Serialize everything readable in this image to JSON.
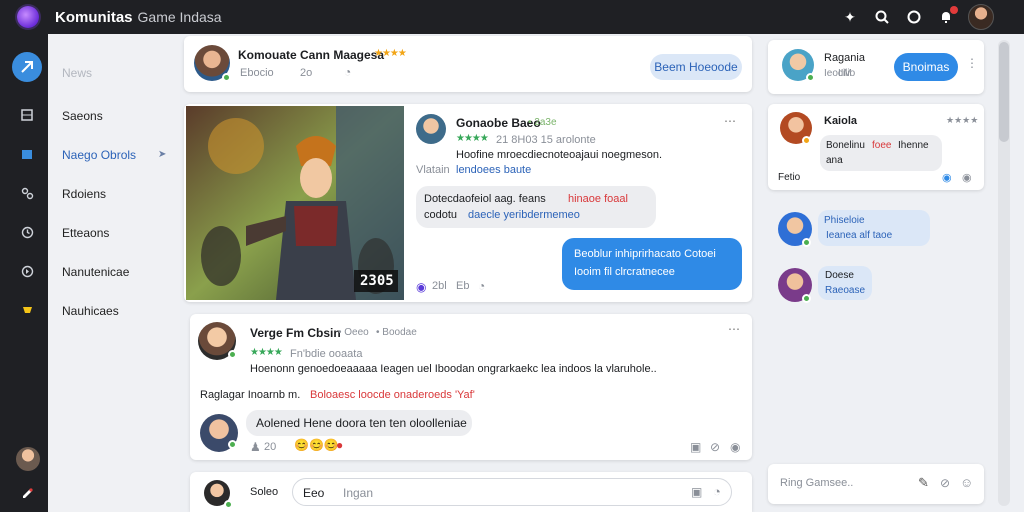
{
  "app": {
    "title": "Komunitas",
    "subtitle": "Game Indasa"
  },
  "nav": {
    "items": [
      {
        "label": "News",
        "state": "muted"
      },
      {
        "label": "Saeons",
        "state": "normal"
      },
      {
        "label": "Naego Obrols",
        "state": "active"
      },
      {
        "label": "Rdoiens",
        "state": "normal"
      },
      {
        "label": "Etteaons",
        "state": "normal"
      },
      {
        "label": "Nanutenicae",
        "state": "normal"
      },
      {
        "label": "Nauhicaes",
        "state": "normal"
      }
    ]
  },
  "profile_card": {
    "name": "Komouate Cann Maagesa",
    "stars": "★★★★",
    "meta1": "Ebocio",
    "meta2": "2o",
    "button": "Beem Hoeoode"
  },
  "post1": {
    "image_score": "2305",
    "author": "Gonaobe Baeo",
    "author_tag": "• 2a3e",
    "stars": "★★★★",
    "meta": "21 8H03 15 arolonte",
    "text": "Hoofine mroecdiecnoteoajaui noegmeson.",
    "label": "Vlatain",
    "link": "lendoees baute",
    "bubble1_a": "Dotecdaofeiol aag. feans",
    "bubble1_red": "hinaoe foaal",
    "bubble1_b": "codotu",
    "bubble1_blue": "daecle yeribdermemeo",
    "bubble2_a": "Beoblur inhiprirhacato Cotoei",
    "bubble2_b": "Iooim fil clrcratnecee",
    "reactions": "2bl",
    "reactions2": "Eb"
  },
  "post2": {
    "author": "Verge Fm Cbsin",
    "author_tag": "• Oeeo",
    "author_tag2": "• Boodae",
    "stars": "★★★★",
    "meta": "Fn'bdie ooaata",
    "text": "Hoenonn genoedoeaaaaa Ieagen uel Iboodan ongrarkaekc lea indoos la vlaruhole..",
    "reply_prefix": "Raglagar Inoarnb m.",
    "reply_red": "Boloaesc loocde onaderoeds 'Yaf'",
    "comment": "Aolened Hene doora ten ten oloolleniae",
    "comment_count": "20"
  },
  "compose": {
    "name": "Soleo",
    "prefix": "Eeo",
    "placeholder": "Ingan"
  },
  "right_top": {
    "name": "Ragania",
    "tag": "Ieocilio",
    "meta": "IIM",
    "button": "Bnoimas"
  },
  "right_chat": {
    "name": "Kaiola",
    "stars": "★★★★",
    "bubble_a": "Bonelinu",
    "bubble_red": "foee",
    "bubble_b": "Ihenne",
    "bubble_c": "ana",
    "footer": "Fetio"
  },
  "right_float": {
    "b1": "Phiseloie",
    "b1b": "Ieanea alf taoe",
    "b2": "Doese",
    "b2b": "Raeoase"
  },
  "right_compose": {
    "placeholder": "Ring Gamsee.."
  },
  "colors": {
    "accent": "#2f8ae6",
    "topbar": "#1f2024",
    "background": "#eef0f4"
  }
}
